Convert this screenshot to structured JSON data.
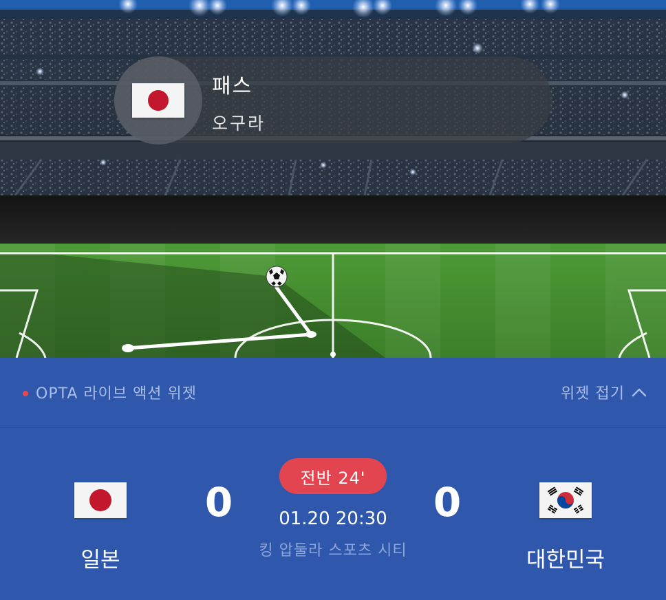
{
  "event": {
    "type": "패스",
    "player": "오구라"
  },
  "widget": {
    "title": "OPTA 라이브 액션 위젯",
    "collapse_label": "위젯 접기"
  },
  "match": {
    "period": "전반 24'",
    "datetime": "01.20 20:30",
    "venue": "킹 압둘라 스포츠 시티",
    "home": {
      "name": "일본",
      "score": "0",
      "flag": "japan-flag"
    },
    "away": {
      "name": "대한민국",
      "score": "0",
      "flag": "south-korea-flag"
    }
  },
  "colors": {
    "panel": "#2f58ad",
    "accent_red": "#e2454f",
    "muted_text": "#a9bde6",
    "pitch": "#3f8a2c"
  }
}
